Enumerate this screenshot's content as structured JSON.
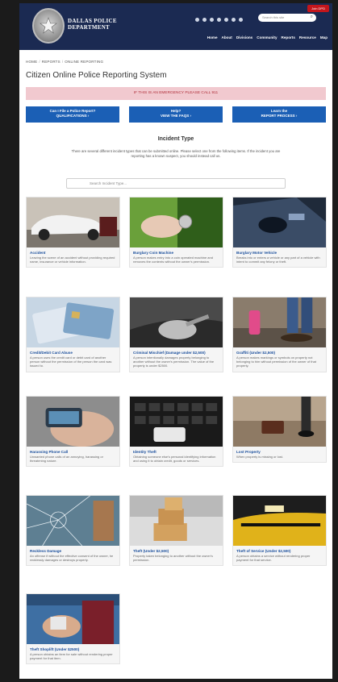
{
  "header": {
    "brand_line1": "DALLAS POLICE",
    "brand_line2": "DEPARTMENT",
    "join_label": "Join DPD",
    "search_placeholder": "Search this site",
    "nav": [
      "Home",
      "About",
      "Divisions",
      "Community",
      "Reports",
      "Resource",
      "Map"
    ]
  },
  "breadcrumb": [
    "HOME",
    "REPORTS",
    "ONLINE REPORTING"
  ],
  "page_title": "Citizen Online Police Reporting System",
  "emergency_text": "IF THIS IS AN EMERGENCY PLEASE CALL 911",
  "info_buttons": [
    {
      "line1": "Can I File a Police Report?",
      "line2": "QUALIFICATIONS  ›"
    },
    {
      "line1": "Help?",
      "line2": "VIEW THE FAQS  ›"
    },
    {
      "line1": "Learn the",
      "line2": "REPORT PROCESS  ›"
    }
  ],
  "incident": {
    "title": "Incident Type",
    "description": "There are several different incident types that can be submitted online. Please select one from the following items. If the incident you are reporting has a known suspect, you should instead call us.",
    "search_placeholder": "Search Incident Type..."
  },
  "cards": [
    {
      "title": "Accident",
      "desc": "Leaving the scene of an accident without providing required name, insurance or vehicle information.",
      "icon": "car-accident"
    },
    {
      "title": "Burglary Coin Machine",
      "desc": "A person makes entry into a coin operated machine and removes the contents without the owner's permission.",
      "icon": "coin-machine"
    },
    {
      "title": "Burglary Motor Vehicle",
      "desc": "Breaks into or enters a vehicle or any part of a vehicle with intent to commit any felony or theft.",
      "icon": "vehicle-break-in"
    },
    {
      "title": "Credit/Debit Card Abuse",
      "desc": "A person uses the credit card or debit card of another person without the permission of the person the card was issued to.",
      "icon": "credit-cards"
    },
    {
      "title": "Criminal Mischief (Damage under $2,500)",
      "desc": "A person intentionally damages property belonging to another without the owner's permission. The value of the property is under $2500.",
      "icon": "damaged-property"
    },
    {
      "title": "Graffiti (Under $2,500)",
      "desc": "A person makes markings or symbols on property not belonging to him without permission of the owner of that property.",
      "icon": "spray-paint"
    },
    {
      "title": "Harassing Phone Call",
      "desc": "Unwanted phone calls of an annoying, harassing or threatening nature.",
      "icon": "phone"
    },
    {
      "title": "Identity Theft",
      "desc": "Obtaining someone else's personal identifying information and using it to obtain credit, goods or services.",
      "icon": "keyboard"
    },
    {
      "title": "Lost Property",
      "desc": "When property is missing or lost.",
      "icon": "lost-wallet"
    },
    {
      "title": "Reckless Damage",
      "desc": "An offense if without the effective consent of the owner, he recklessly damages or destroys property.",
      "icon": "broken-glass"
    },
    {
      "title": "Theft (Under $2,500)",
      "desc": "Property taken belonging to another without the owner's permission.",
      "icon": "boxes"
    },
    {
      "title": "Theft of Service (Under $2,500)",
      "desc": "A person obtains a service without rendering proper payment for that service.",
      "icon": "taxi"
    },
    {
      "title": "Theft Shoplift (Under $2500)",
      "desc": "A person obtains an item for sale without rendering proper payment for that item.",
      "icon": "shoplift"
    }
  ],
  "colors": {
    "header": "#1b2a52",
    "primary_button": "#1b5fb5",
    "emergency_bg": "#f1c9cf",
    "emergency_text": "#b0303b",
    "card_title": "#1b4f9c"
  }
}
